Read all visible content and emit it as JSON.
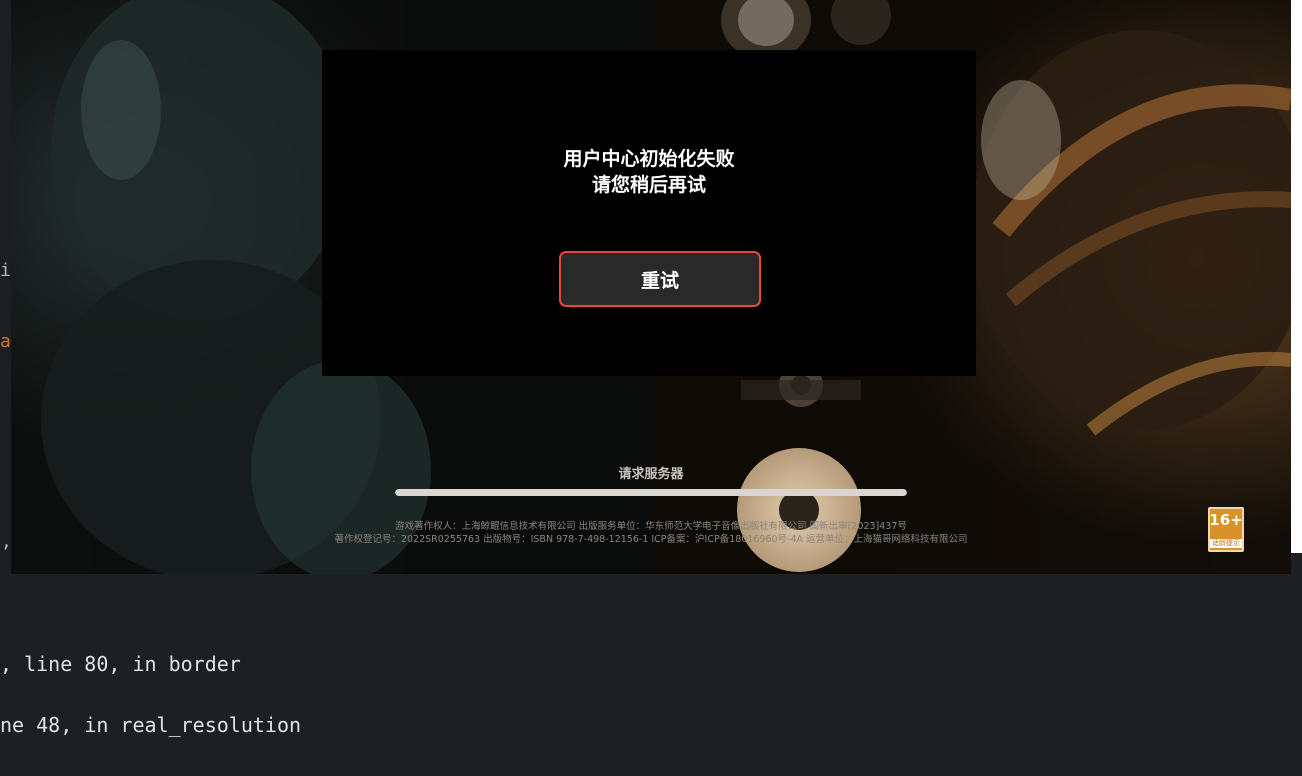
{
  "editor": {
    "gutter_fragments": [
      "i",
      "a",
      ","
    ],
    "console_lines": [
      ", line 80, in border",
      "ne 48, in real_resolution"
    ]
  },
  "game": {
    "modal": {
      "message_line1": "用户中心初始化失败",
      "message_line2": "请您稍后再试",
      "retry_label": "重试"
    },
    "loading": {
      "label": "请求服务器",
      "progress_fraction": 1.0
    },
    "copyright": {
      "line1": "游戏著作权人：上海鲸鲲信息技术有限公司  出版服务单位：华东师范大学电子音像出版社有限公司   国新出审[2023]437号",
      "line2": "著作权登记号：2022SR0255763 出版物号：ISBN 978-7-498-12156-1 ICP备案：沪ICP备18016960号-4A  运营单位：上海猫哥网络科技有限公司"
    },
    "age_rating": {
      "number": "16+",
      "text": "适龄提示"
    }
  },
  "colors": {
    "modal_bg": "#000000",
    "retry_border": "#e8453c",
    "retry_bg": "#2a292a",
    "progress_fill": "#d9d6d2",
    "age_badge": "#d9912a"
  }
}
